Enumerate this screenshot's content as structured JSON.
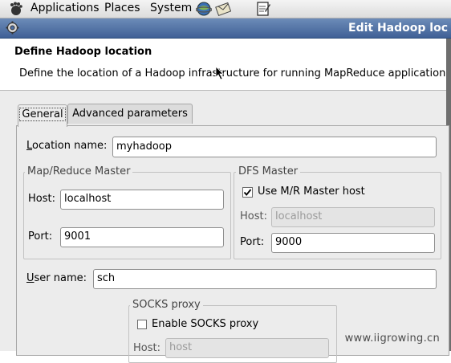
{
  "top_panel": {
    "menus": [
      "Applications",
      "Places",
      "System"
    ]
  },
  "window": {
    "title": "Edit Hadoop loc"
  },
  "header": {
    "title": "Define Hadoop location",
    "description": "Define the location of a Hadoop infrastructure for running MapReduce applications."
  },
  "tabs": [
    {
      "label": "General",
      "selected": true
    },
    {
      "label": "Advanced parameters",
      "selected": false
    }
  ],
  "form": {
    "location_name": {
      "pre": "",
      "mnemonic": "L",
      "post": "ocation name:",
      "value": "myhadoop"
    },
    "mr_master": {
      "legend": "Map/Reduce Master",
      "host_label": "Host:",
      "host_value": "localhost",
      "port_label": "Port:",
      "port_value": "9001"
    },
    "dfs_master": {
      "legend": "DFS Master",
      "use_mr_label": "Use M/R Master host",
      "use_mr_checked": true,
      "host_label": "Host:",
      "host_value": "localhost",
      "port_label": "Port:",
      "port_value": "9000"
    },
    "user_name": {
      "pre": "",
      "mnemonic": "U",
      "post": "ser name:",
      "value": "sch"
    },
    "socks": {
      "legend": "SOCKS proxy",
      "enable_label": "Enable SOCKS proxy",
      "enable_checked": false,
      "host_label": "Host:",
      "host_value": "host"
    }
  },
  "watermark": "www.iigrowing.cn"
}
